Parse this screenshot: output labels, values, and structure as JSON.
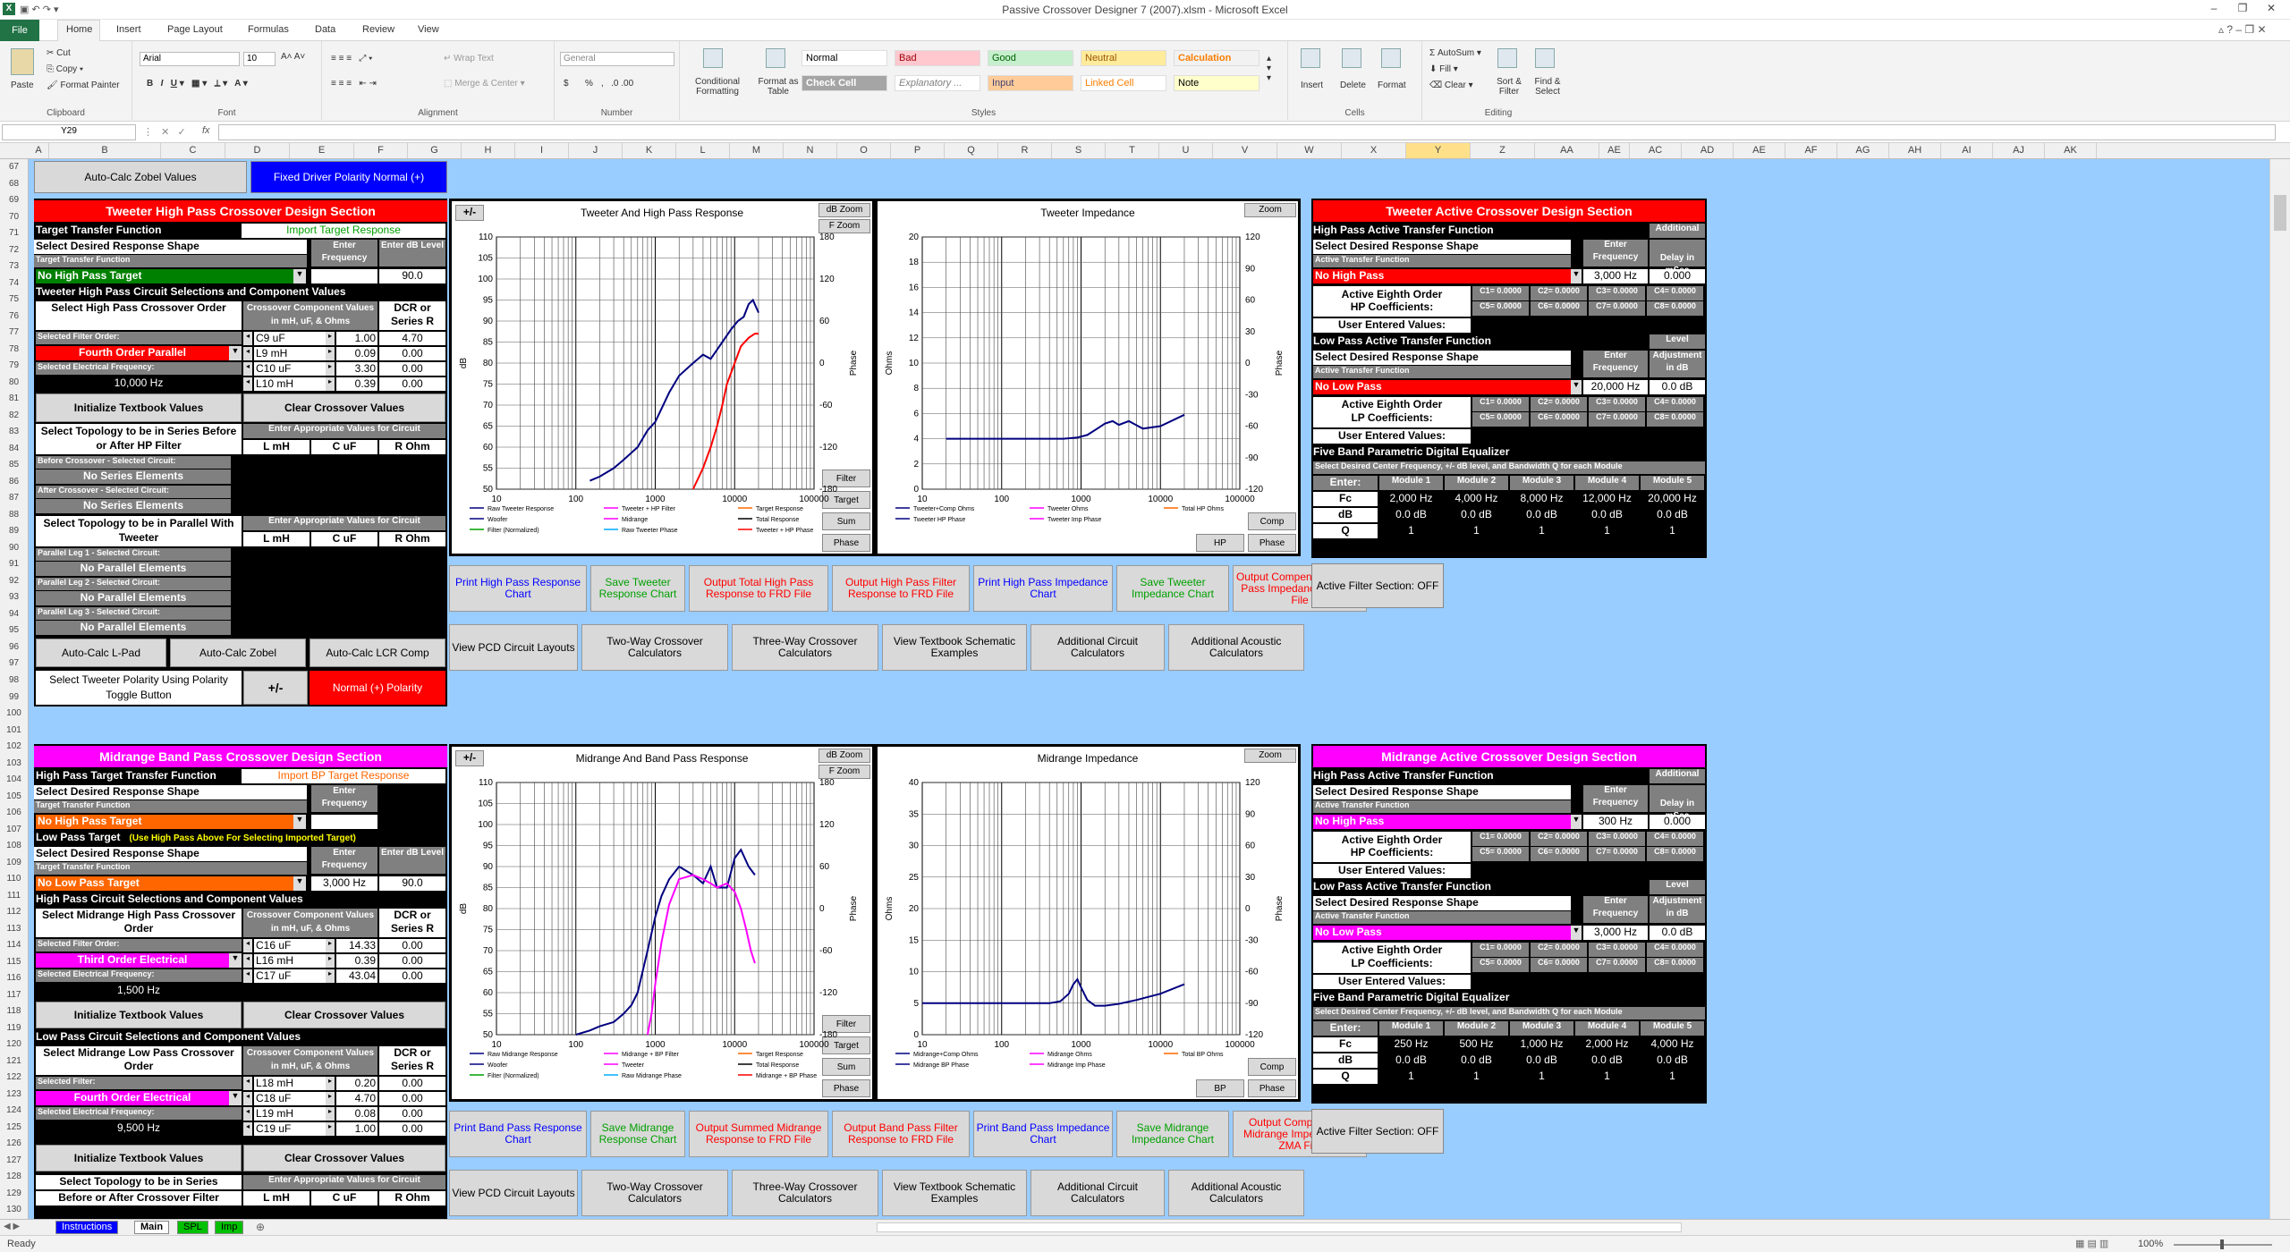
{
  "window": {
    "title": "Passive Crossover Designer 7 (2007).xlsm - Microsoft Excel",
    "file_tab": "File"
  },
  "ribbon_tabs": [
    "Home",
    "Insert",
    "Page Layout",
    "Formulas",
    "Data",
    "Review",
    "View"
  ],
  "ribbon": {
    "clipboard": {
      "label": "Clipboard",
      "paste": "Paste",
      "cut": "Cut",
      "copy": "Copy",
      "format_painter": "Format Painter"
    },
    "font": {
      "label": "Font",
      "name": "Arial",
      "size": "10"
    },
    "alignment": {
      "label": "Alignment",
      "wrap": "Wrap Text",
      "merge": "Merge & Center"
    },
    "number": {
      "label": "Number",
      "format": "General",
      "currency": "$",
      "pct": "%"
    },
    "styles": {
      "label": "Styles",
      "cond": "Conditional Formatting",
      "table": "Format as Table",
      "cells": [
        "Normal",
        "Bad",
        "Good",
        "Neutral",
        "Calculation",
        "Check Cell",
        "Explanatory ...",
        "Input",
        "Linked Cell",
        "Note"
      ]
    },
    "cells": {
      "label": "Cells",
      "insert": "Insert",
      "delete": "Delete",
      "format": "Format"
    },
    "editing": {
      "label": "Editing",
      "autosum": "AutoSum",
      "fill": "Fill",
      "clear": "Clear",
      "sort": "Sort & Filter",
      "find": "Find & Select"
    }
  },
  "formula_bar": {
    "name_box": "Y29",
    "fx": "fx"
  },
  "columns": [
    "A",
    "B",
    "C",
    "D",
    "E",
    "F",
    "G",
    "H",
    "I",
    "J",
    "K",
    "L",
    "M",
    "N",
    "O",
    "P",
    "Q",
    "R",
    "S",
    "T",
    "U",
    "V",
    "W",
    "X",
    "Y",
    "Z",
    "AA",
    "AE",
    "AC",
    "AD",
    "AE",
    "AF",
    "AG",
    "AH",
    "AI",
    "AJ",
    "AK"
  ],
  "rows": [
    "67",
    "68",
    "69",
    "70",
    "71",
    "72",
    "73",
    "74",
    "75",
    "76",
    "77",
    "78",
    "79",
    "80",
    "81",
    "82",
    "83",
    "84",
    "85",
    "86",
    "87",
    "88",
    "89",
    "90",
    "91",
    "92",
    "93",
    "94",
    "95",
    "96",
    "97",
    "98",
    "99",
    "100",
    "101",
    "102",
    "103",
    "104",
    "105",
    "106",
    "107",
    "108",
    "109",
    "110",
    "111",
    "112",
    "113",
    "114",
    "115",
    "116",
    "117",
    "118",
    "119",
    "120",
    "121",
    "122",
    "123",
    "124",
    "125",
    "126",
    "127",
    "128",
    "129",
    "130"
  ],
  "top_buttons": {
    "zobel": "Auto-Calc Zobel Values",
    "polarity": "Fixed Driver Polarity Normal (+)"
  },
  "tweeter": {
    "title": "Tweeter High Pass Crossover Design Section",
    "target_tf": "Target Transfer Function",
    "import": "Import Target Response",
    "select_shape": "Select Desired Response Shape",
    "enter_freq": "Enter Frequency",
    "enter_db": "Enter dB Level",
    "target_tf2": "Target Transfer Function",
    "target_val": "No High Pass Target",
    "db_val": "90.0",
    "circuit_head": "Tweeter High Pass Circuit Selections and Component Values",
    "select_hp": "Select High Pass Crossover Order",
    "comp_vals": "Crossover Component Values in mH, uF, & Ohms",
    "dcr": "DCR or Series R",
    "filter_order_lbl": "Selected Filter Order:",
    "filter_order": "Fourth Order Parallel",
    "elec_freq_lbl": "Selected Electrical Frequency:",
    "elec_freq": "10,000 Hz",
    "comps": [
      [
        "C9 uF",
        "1.00",
        "4.70"
      ],
      [
        "L9 mH",
        "0.09",
        "0.00"
      ],
      [
        "C10 uF",
        "3.30",
        "0.00"
      ],
      [
        "L10 mH",
        "0.39",
        "0.00"
      ]
    ],
    "init": "Initialize Textbook Values",
    "clear": "Clear Crossover Values",
    "series_head": "Select Topology to be in Series Before or After HP Filter",
    "enter_vals": "Enter Appropriate Values for Circuit",
    "lmh": "L mH",
    "cuf": "C uF",
    "rohm": "R Ohm",
    "before_lbl": "Before Crossover - Selected Circuit:",
    "after_lbl": "After Crossover - Selected Circuit:",
    "no_series": "No Series Elements",
    "par_head": "Select Topology to be in Parallel With Tweeter",
    "legs": [
      "Parallel Leg 1 - Selected Circuit:",
      "Parallel Leg 2 - Selected Circuit:",
      "Parallel Leg 3 - Selected Circuit:"
    ],
    "no_par": "No Parallel Elements",
    "lpad": "Auto-Calc L-Pad",
    "zobel": "Auto-Calc Zobel",
    "lcr": "Auto-Calc LCR Comp",
    "pol_lbl": "Select Tweeter Polarity Using Polarity Toggle Button",
    "pm": "+/-",
    "pol": "Normal (+) Polarity"
  },
  "midrange": {
    "title": "Midrange Band Pass Crossover Design Section",
    "hp_target": "High Pass Target Transfer Function",
    "import": "Import BP Target Response",
    "select_shape": "Select Desired Response Shape",
    "enter_freq": "Enter Frequency",
    "target_tf": "Target Transfer Function",
    "hp_val": "No High Pass Target",
    "lp_target": "Low Pass Target",
    "lp_hint": "(Use High Pass Above For Selecting Imported Target)",
    "enter_db": "Enter dB Level",
    "lp_val": "No Low Pass Target",
    "lp_freq": "3,000 Hz",
    "lp_db": "90.0",
    "hp_head": "High Pass Circuit Selections and Component Values",
    "select_mid_hp": "Select Midrange High Pass Crossover Order",
    "comp_vals": "Crossover Component Values in mH, uF, & Ohms",
    "dcr": "DCR or Series R",
    "hp_order_lbl": "Selected Filter Order:",
    "hp_order": "Third Order Electrical",
    "elec_freq_lbl": "Selected Electrical Frequency:",
    "hp_freq": "1,500 Hz",
    "hp_comps": [
      [
        "C16 uF",
        "14.33",
        "0.00"
      ],
      [
        "L16 mH",
        "0.39",
        "0.00"
      ],
      [
        "C17 uF",
        "43.04",
        "0.00"
      ]
    ],
    "init": "Initialize Textbook Values",
    "clear": "Clear Crossover Values",
    "lp_head": "Low Pass Circuit Selections and Component Values",
    "select_mid_lp": "Select Midrange Low Pass Crossover Order",
    "lp_filter_lbl": "Selected Filter:",
    "lp_order": "Fourth Order Electrical",
    "lp_freq2": "9,500 Hz",
    "lp_comps": [
      [
        "L18 mH",
        "0.20",
        "0.00"
      ],
      [
        "C18 uF",
        "4.70",
        "0.00"
      ],
      [
        "L19 mH",
        "0.08",
        "0.00"
      ],
      [
        "C19 uF",
        "1.00",
        "0.00"
      ]
    ],
    "series_head": "Select Topology to be in Series",
    "series_head2": "Before or After Crossover Filter",
    "enter_vals": "Enter Appropriate Values for Circuit",
    "lmh": "L mH",
    "cuf": "C uF",
    "rohm": "R Ohm"
  },
  "charts": {
    "tw_resp": {
      "title": "Tweeter And High Pass Response",
      "pm": "+/-",
      "dbzoom": "dB Zoom",
      "fzoom": "F Zoom",
      "buttons": [
        "Filter",
        "Target",
        "Sum",
        "Phase"
      ],
      "ylabel": "dB",
      "y2label": "Phase",
      "legend": [
        "Raw Tweeter Response",
        "Tweeter + HP Filter",
        "Target Response",
        "Woofer",
        "Midrange",
        "Total Response",
        "Filter (Normalized)",
        "Raw Tweeter Phase",
        "Tweeter + HP Phase"
      ]
    },
    "tw_imp": {
      "title": "Tweeter Impedance",
      "zoom": "Zoom",
      "ylabel": "Ohms",
      "y2label": "Phase",
      "buttons": [
        "Comp",
        "HP",
        "Phase"
      ],
      "legend": [
        "Tweeter+Comp Ohms",
        "Tweeter Ohms",
        "Total HP Ohms",
        "Tweeter HP Phase",
        "Tweeter Imp Phase"
      ]
    },
    "mid_resp": {
      "title": "Midrange And Band Pass Response",
      "pm": "+/-",
      "dbzoom": "dB Zoom",
      "fzoom": "F Zoom",
      "buttons": [
        "Filter",
        "Target",
        "Sum",
        "Phase"
      ],
      "ylabel": "dB",
      "y2label": "Phase",
      "legend": [
        "Raw Midrange Response",
        "Midrange + BP Filter",
        "Target Response",
        "Woofer",
        "Tweeter",
        "Total Response",
        "Filter (Normalized)",
        "Raw Midrange Phase",
        "Midrange + BP Phase"
      ]
    },
    "mid_imp": {
      "title": "Midrange Impedance",
      "zoom": "Zoom",
      "ylabel": "Ohms",
      "y2label": "Phase",
      "buttons": [
        "Comp",
        "BP",
        "Phase"
      ],
      "legend": [
        "Midrange+Comp Ohms",
        "Midrange Ohms",
        "Total BP Ohms",
        "Midrange BP Phase",
        "Midrange Imp Phase"
      ]
    }
  },
  "chart_data": [
    {
      "type": "line",
      "title": "Tweeter And High Pass Response",
      "ylabel": "dB",
      "y2label": "Phase",
      "xscale": "log",
      "xlim": [
        10,
        100000
      ],
      "ylim": [
        50,
        110
      ],
      "y2lim": [
        -180,
        180
      ],
      "x_ticks": [
        "10",
        "100",
        "1000",
        "10000",
        "100000"
      ],
      "y_ticks": [
        50,
        55,
        60,
        65,
        70,
        75,
        80,
        85,
        90,
        95,
        100,
        105,
        110
      ],
      "y2_ticks": [
        -180,
        -120,
        -60,
        0,
        60,
        120,
        180
      ],
      "series": [
        {
          "name": "Raw Tweeter Response",
          "color": "#000080",
          "x": [
            150,
            200,
            300,
            400,
            600,
            800,
            1000,
            1500,
            2000,
            3000,
            4000,
            5000,
            7000,
            9000,
            11000,
            13000,
            15000,
            17000,
            20000
          ],
          "y": [
            52,
            53,
            55,
            57,
            60,
            64,
            66,
            73,
            77,
            80,
            82,
            81,
            85,
            88,
            90,
            91,
            94,
            95,
            92
          ]
        },
        {
          "name": "Tweeter + HP Filter",
          "color": "#ff0000",
          "x": [
            3000,
            4000,
            5000,
            6000,
            7000,
            8000,
            10000,
            12000,
            15000,
            18000,
            20000
          ],
          "y": [
            50,
            55,
            60,
            65,
            70,
            75,
            80,
            84,
            86,
            87,
            87
          ]
        }
      ]
    },
    {
      "type": "line",
      "title": "Tweeter Impedance",
      "ylabel": "Ohms",
      "y2label": "Phase",
      "xscale": "log",
      "xlim": [
        10,
        100000
      ],
      "ylim": [
        0,
        20
      ],
      "y2lim": [
        -120,
        120
      ],
      "x_ticks": [
        "10",
        "100",
        "1000",
        "10000",
        "100000"
      ],
      "y_ticks": [
        0,
        2,
        4,
        6,
        8,
        10,
        12,
        14,
        16,
        18,
        20
      ],
      "y2_ticks": [
        -120,
        -90,
        -60,
        -30,
        0,
        30,
        60,
        90,
        120
      ],
      "series": [
        {
          "name": "Tweeter Ohms",
          "color": "#000080",
          "x": [
            20,
            100,
            300,
            600,
            900,
            1200,
            1600,
            2000,
            2500,
            3000,
            4000,
            6000,
            10000,
            20000
          ],
          "y": [
            4,
            4,
            4,
            4,
            4.1,
            4.3,
            4.8,
            5.2,
            5.4,
            5.1,
            5.4,
            4.8,
            5,
            5.9
          ]
        }
      ]
    },
    {
      "type": "line",
      "title": "Midrange And Band Pass Response",
      "ylabel": "dB",
      "y2label": "Phase",
      "xscale": "log",
      "xlim": [
        10,
        100000
      ],
      "ylim": [
        50,
        110
      ],
      "y2lim": [
        -180,
        180
      ],
      "x_ticks": [
        "10",
        "100",
        "1000",
        "10000",
        "100000"
      ],
      "y_ticks": [
        50,
        55,
        60,
        65,
        70,
        75,
        80,
        85,
        90,
        95,
        100,
        105,
        110
      ],
      "y2_ticks": [
        -180,
        -120,
        -60,
        0,
        60,
        120,
        180
      ],
      "series": [
        {
          "name": "Raw Midrange Response",
          "color": "#000080",
          "x": [
            100,
            150,
            200,
            300,
            400,
            500,
            600,
            800,
            1000,
            1200,
            1500,
            2000,
            3000,
            4000,
            5000,
            6000,
            8000,
            10000,
            12000,
            15000,
            18000
          ],
          "y": [
            50,
            51,
            52,
            53,
            55,
            57,
            60,
            70,
            78,
            83,
            87,
            90,
            88,
            86,
            90,
            85,
            85,
            92,
            94,
            90,
            88
          ]
        },
        {
          "name": "Midrange + BP Filter",
          "color": "#ff00ff",
          "x": [
            800,
            900,
            1000,
            1200,
            1500,
            2000,
            3000,
            4000,
            5000,
            6000,
            8000,
            10000,
            12000,
            14000,
            16000,
            18000
          ],
          "y": [
            50,
            55,
            62,
            72,
            81,
            87,
            88,
            87,
            86,
            85,
            86,
            84,
            80,
            75,
            70,
            67
          ]
        }
      ]
    },
    {
      "type": "line",
      "title": "Midrange Impedance",
      "ylabel": "Ohms",
      "y2label": "Phase",
      "xscale": "log",
      "xlim": [
        10,
        100000
      ],
      "ylim": [
        0,
        40
      ],
      "y2lim": [
        -120,
        120
      ],
      "x_ticks": [
        "10",
        "100",
        "1000",
        "10000",
        "100000"
      ],
      "y_ticks": [
        0,
        5,
        10,
        15,
        20,
        25,
        30,
        35,
        40
      ],
      "y2_ticks": [
        -120,
        -90,
        -60,
        -30,
        0,
        30,
        60,
        90,
        120
      ],
      "series": [
        {
          "name": "Midrange Ohms",
          "color": "#000080",
          "x": [
            10,
            100,
            400,
            550,
            700,
            800,
            900,
            1000,
            1200,
            1500,
            2000,
            3000,
            5000,
            10000,
            20000
          ],
          "y": [
            5,
            5,
            5,
            5.3,
            6.5,
            8,
            8.8,
            7.5,
            5.5,
            4.6,
            4.6,
            4.9,
            5.5,
            6.5,
            8
          ]
        }
      ]
    }
  ],
  "export_buttons": {
    "row1": [
      "Print High Pass Response Chart",
      "Save Tweeter Response Chart",
      "Output Total High Pass Response to FRD File",
      "Output High Pass Filter Response to FRD File",
      "Print High Pass Impedance Chart",
      "Save Tweeter Impedance Chart",
      "Output Compensated High Pass Impedance to ZMA File"
    ],
    "row2": [
      "View PCD Circuit Layouts",
      "Two-Way Crossover Calculators",
      "Three-Way Crossover Calculators",
      "View Textbook Schematic Examples",
      "Additional Circuit Calculators",
      "Additional Acoustic Calculators"
    ],
    "row3": [
      "Print Band Pass Response Chart",
      "Save Midrange Response Chart",
      "Output Summed Midrange Response to FRD File",
      "Output Band Pass Filter Response to FRD File",
      "Print Band Pass Impedance Chart",
      "Save Midrange Impedance Chart",
      "Output Compensated Midrange Impedance to ZMA File"
    ],
    "row4": [
      "View PCD Circuit Layouts",
      "Two-Way Crossover Calculators",
      "Three-Way Crossover Calculators",
      "View Textbook Schematic Examples",
      "Additional Circuit Calculators",
      "Additional Acoustic Calculators"
    ]
  },
  "tw_active": {
    "title": "Tweeter Active Crossover Design Section",
    "hp_tf": "High Pass Active Transfer Function",
    "additional": "Additional",
    "select": "Select Desired Response Shape",
    "delay": "Delay in mSec",
    "atf": "Active Transfer Function",
    "enter": "Enter",
    "freq": "Frequency",
    "hp_val": "No High Pass",
    "hp_freq": "3,000 Hz",
    "hp_delay": "0.000",
    "aeo": "Active Eighth Order",
    "hpc": "HP Coefficients:",
    "lpc": "LP Coefficients:",
    "coefs1": [
      "C1= 0.0000",
      "C2= 0.0000",
      "C3= 0.0000",
      "C4= 0.0000"
    ],
    "coefs2": [
      "C5= 0.0000",
      "C6= 0.0000",
      "C7= 0.0000",
      "C8= 0.0000"
    ],
    "uev": "User Entered Values:",
    "lp_tf": "Low Pass Active Transfer Function",
    "level": "Level",
    "adj": "Adjustment",
    "indb": "in dB",
    "lp_val": "No Low Pass",
    "lp_freq": "20,000 Hz",
    "lp_db": "0.0 dB",
    "peq": "Five Band Parametric Digital Equalizer",
    "peq_hint": "Select Desired Center Frequency, +/- dB level, and Bandwidth Q for each Module",
    "enter_lbl": "Enter:",
    "modules": [
      "Module 1",
      "Module 2",
      "Module 3",
      "Module 4",
      "Module 5"
    ],
    "fc_lbl": "Fc",
    "db_lbl": "dB",
    "q_lbl": "Q",
    "fc": [
      "2,000 Hz",
      "4,000 Hz",
      "8,000 Hz",
      "12,000 Hz",
      "20,000 Hz"
    ],
    "db": [
      "0.0 dB",
      "0.0 dB",
      "0.0 dB",
      "0.0 dB",
      "0.0 dB"
    ],
    "q": [
      "1",
      "1",
      "1",
      "1",
      "1"
    ],
    "afs": "Active Filter Section: OFF"
  },
  "mid_active": {
    "title": "Midrange Active Crossover Design Section",
    "hp_val": "No High Pass",
    "hp_freq": "300 Hz",
    "hp_delay": "0.000",
    "lp_val": "No Low Pass",
    "lp_freq": "3,000 Hz",
    "lp_db": "0.0 dB",
    "fc": [
      "250 Hz",
      "500 Hz",
      "1,000 Hz",
      "2,000 Hz",
      "4,000 Hz"
    ],
    "db": [
      "0.0 dB",
      "0.0 dB",
      "0.0 dB",
      "0.0 dB",
      "0.0 dB"
    ],
    "q": [
      "1",
      "1",
      "1",
      "1",
      "1"
    ],
    "afs": "Active Filter Section: OFF"
  },
  "sheet_tabs": [
    "Instructions",
    "Main",
    "SPL",
    "Imp"
  ],
  "status": {
    "ready": "Ready",
    "zoom": "100%"
  },
  "colors": {
    "tweeter": "#ff0000",
    "midrange": "#ff00ff",
    "sheet_bg": "#99ccff",
    "series_raw": "#000080"
  }
}
